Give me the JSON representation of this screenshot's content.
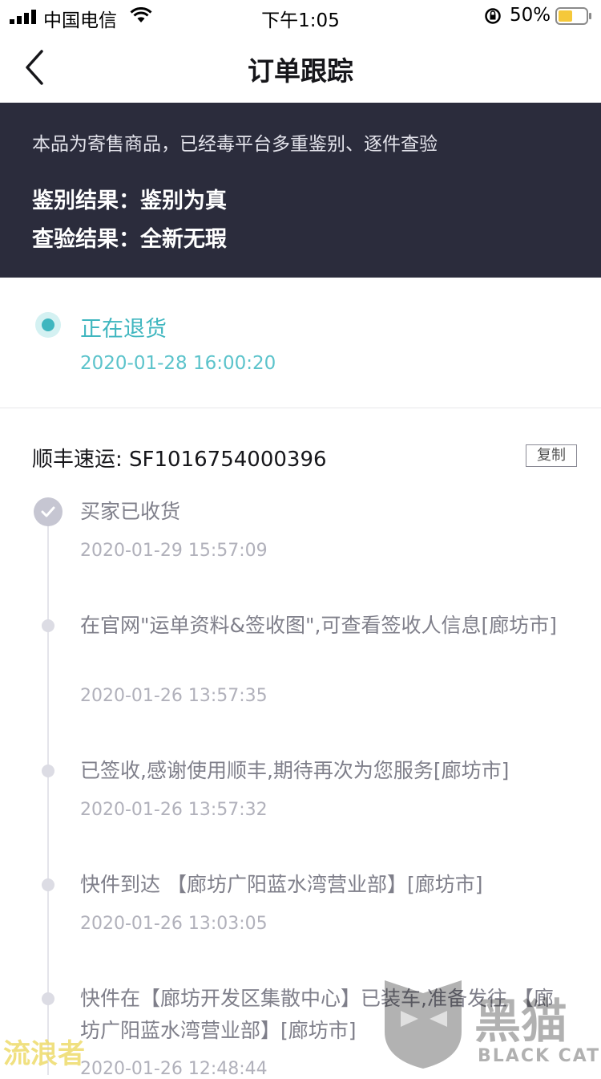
{
  "status_bar": {
    "carrier": "中国电信",
    "time": "下午1:05",
    "battery": "50%"
  },
  "nav": {
    "title": "订单跟踪"
  },
  "banner": {
    "note": "本品为寄售商品，已经毒平台多重鉴别、逐件查验",
    "auth_result": "鉴别结果：鉴别为真",
    "inspect_result": "查验结果：全新无瑕"
  },
  "order_status": {
    "title": "正在退货",
    "time": "2020-01-28 16:00:20"
  },
  "shipping": {
    "carrier_line": "顺丰速运: SF1016754000396",
    "copy_label": "复制"
  },
  "timeline": [
    {
      "text": "买家已收货",
      "time": "2020-01-29 15:57:09"
    },
    {
      "text": "在官网\"运单资料&签收图\",可查看签收人信息[廊坊市]",
      "time": "2020-01-26 13:57:35"
    },
    {
      "text": "已签收,感谢使用顺丰,期待再次为您服务[廊坊市]",
      "time": "2020-01-26 13:57:32"
    },
    {
      "text": "快件到达 【廊坊广阳蓝水湾营业部】[廊坊市]",
      "time": "2020-01-26 13:03:05"
    },
    {
      "text": "快件在【廊坊开发区集散中心】已装车,准备发往 【廊坊广阳蓝水湾营业部】[廊坊市]",
      "time": "2020-01-26 12:48:44"
    }
  ],
  "watermark": {
    "left": "流浪者",
    "logo_text": "黑猫",
    "logo_sub": "BLACK CAT"
  },
  "colors": {
    "accent": "#3fb6bf",
    "banner": "#2b2c3c"
  }
}
